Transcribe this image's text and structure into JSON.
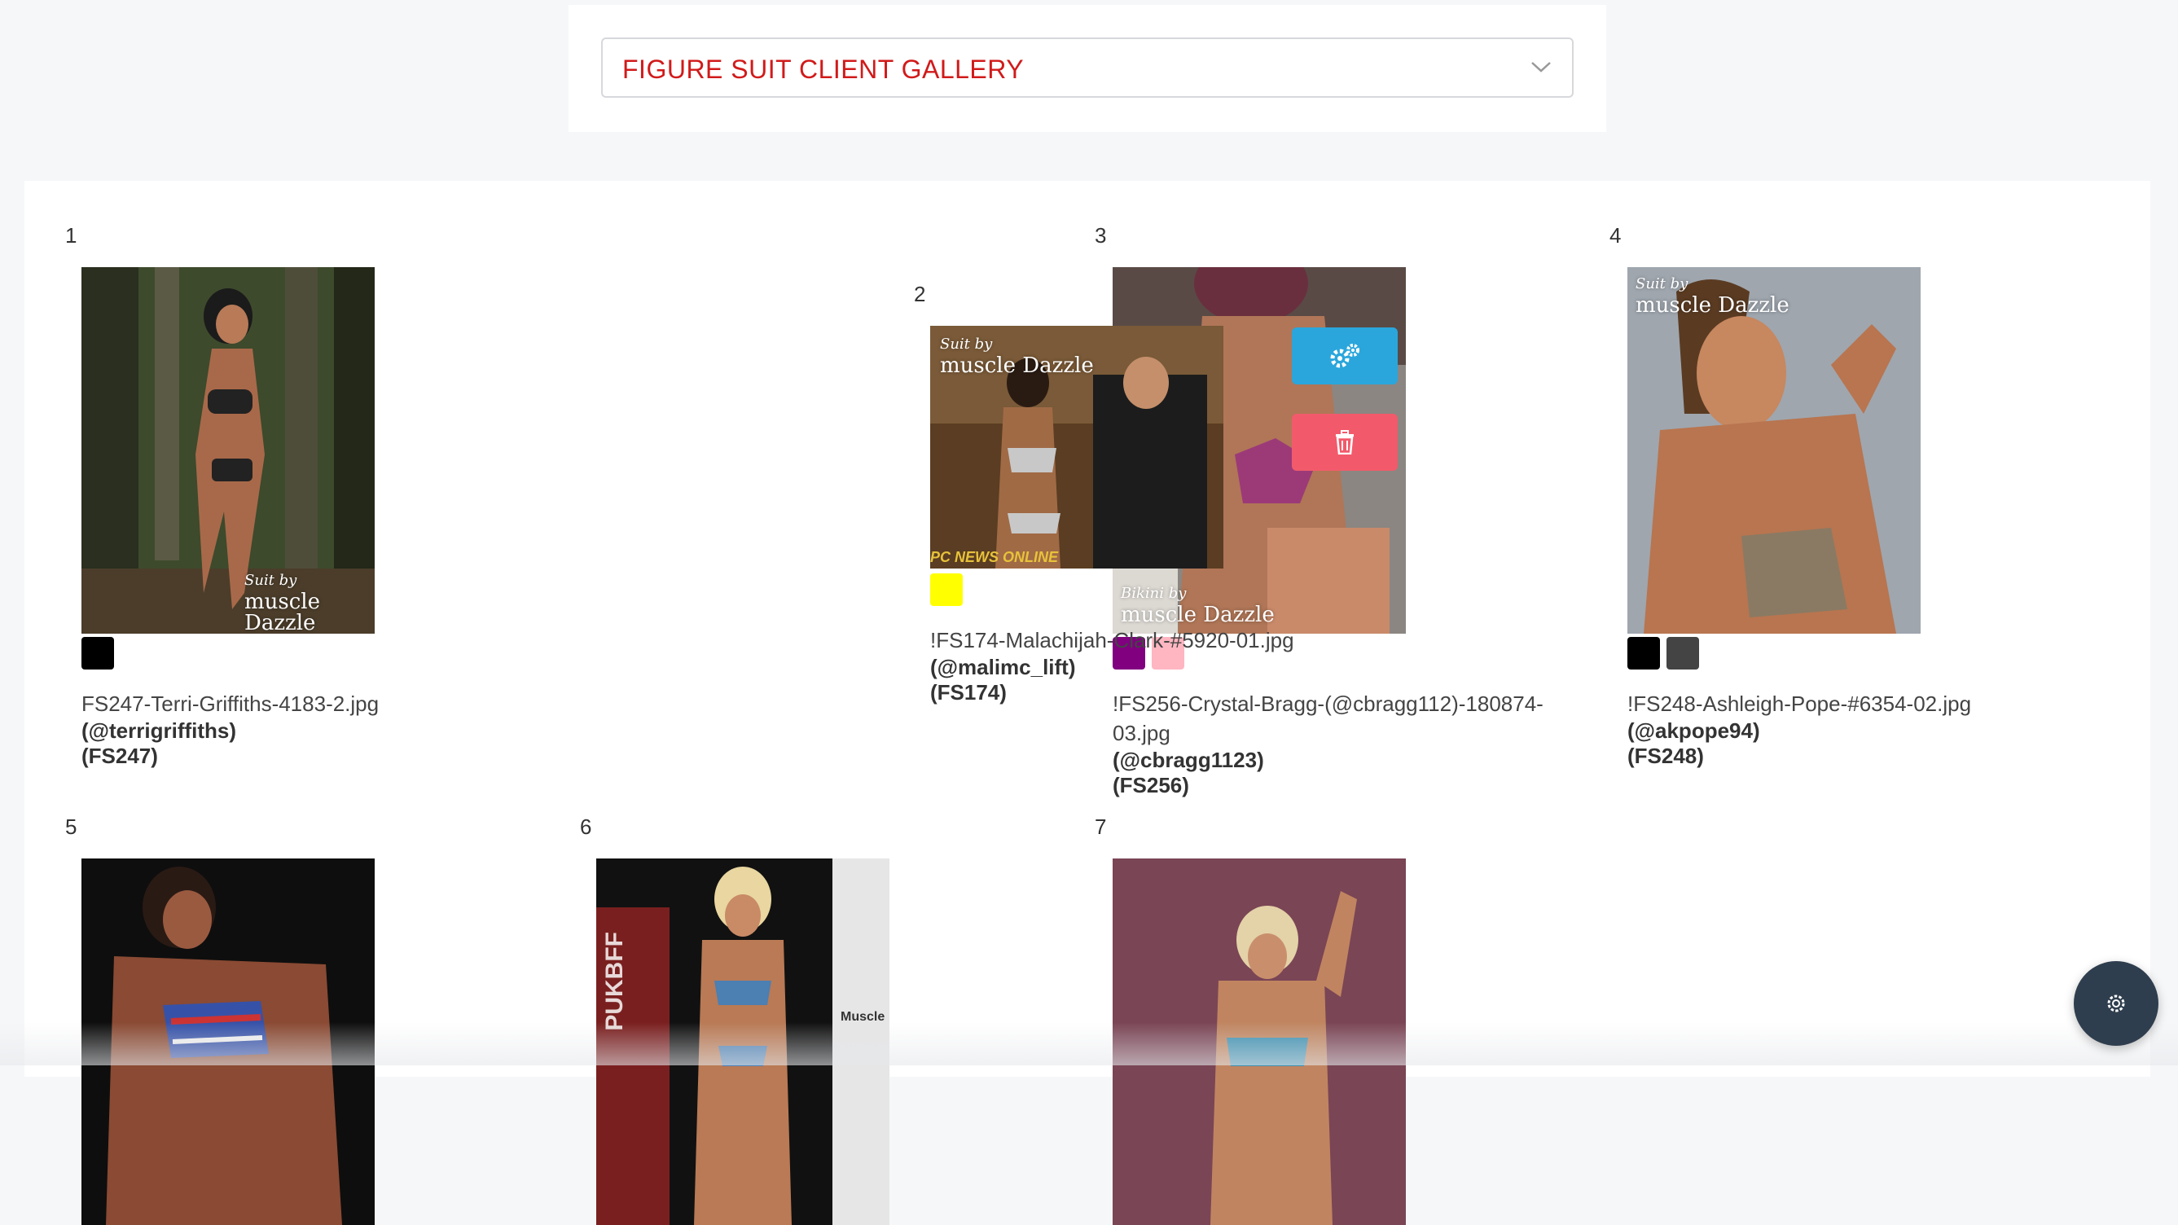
{
  "header": {
    "gallery_select_value": "FIGURE SUIT CLIENT GALLERY",
    "accent_color": "#d11a1a"
  },
  "gallery": [
    {
      "num": "1",
      "filename": "FS247-Terri-Griffiths-4183-2.jpg",
      "handle": "(@terrigriffiths) (FS247)",
      "swatches": [
        "#000000"
      ],
      "watermark_script": "Suit by",
      "watermark_brand": "muscle Dazzle"
    },
    {
      "num": "2",
      "filename": "!FS174-Malachijah-Clark-#5920-01.jpg",
      "handle": "(@malimc_lift) (FS174)",
      "swatches": [
        "#ffff00"
      ],
      "watermark_script": "Suit by",
      "watermark_brand": "muscle Dazzle",
      "overlay_text": "PC NEWS ONLINE"
    },
    {
      "num": "3",
      "filename": "!FS256-Crystal-Bragg-(@cbragg112)-180874-03.jpg",
      "handle": "(@cbragg1123) (FS256)",
      "swatches": [
        "#800080",
        "#ffb6c1"
      ],
      "watermark_script": "Bikini by",
      "watermark_brand": "muscle Dazzle"
    },
    {
      "num": "4",
      "filename": "!FS248-Ashleigh-Pope-#6354-02.jpg",
      "handle": "(@akpope94) (FS248)",
      "swatches": [
        "#000000",
        "#444444"
      ],
      "watermark_script": "Suit by",
      "watermark_brand": "muscle Dazzle"
    },
    {
      "num": "5"
    },
    {
      "num": "6",
      "image_text": "PUKBFF",
      "side_text": "Muscle"
    },
    {
      "num": "7"
    }
  ],
  "actions": {
    "settings_icon": "gears-icon",
    "delete_icon": "trash-icon",
    "settings_color": "#2aa6dc",
    "delete_color": "#f25a6b"
  },
  "fab": {
    "icon": "gear-icon",
    "color": "#2f3e4e"
  }
}
